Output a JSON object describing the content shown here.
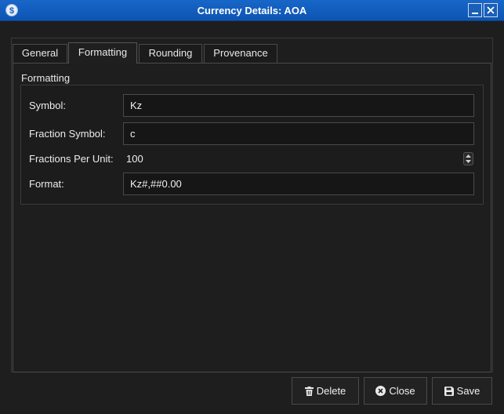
{
  "window": {
    "title": "Currency Details: AOA",
    "icon": "currency-icon",
    "icon_glyph": "$"
  },
  "tabs": [
    {
      "label": "General",
      "active": false
    },
    {
      "label": "Formatting",
      "active": true
    },
    {
      "label": "Rounding",
      "active": false
    },
    {
      "label": "Provenance",
      "active": false
    }
  ],
  "formatting": {
    "group_title": "Formatting",
    "symbol_label": "Symbol:",
    "symbol_value": "Kz",
    "fraction_symbol_label": "Fraction Symbol:",
    "fraction_symbol_value": "c",
    "fractions_per_unit_label": "Fractions Per Unit:",
    "fractions_per_unit_value": "100",
    "format_label": "Format:",
    "format_value": "Kz#,##0.00"
  },
  "buttons": {
    "delete_label": "Delete",
    "close_label": "Close",
    "save_label": "Save"
  },
  "colors": {
    "titlebar": "#1766c8",
    "background": "#1e1e1e"
  }
}
